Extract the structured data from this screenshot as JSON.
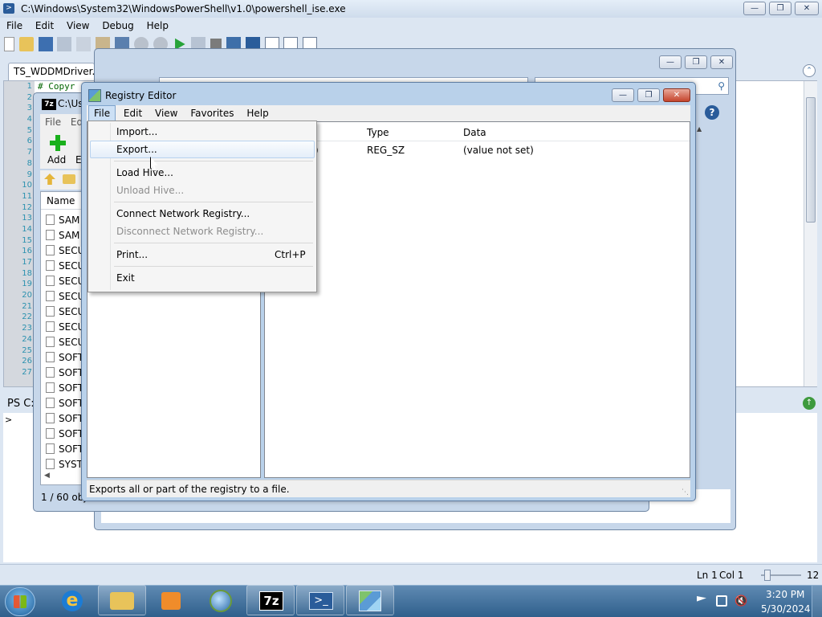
{
  "ise": {
    "title": "C:\\Windows\\System32\\WindowsPowerShell\\v1.0\\powershell_ise.exe",
    "menu": [
      "File",
      "Edit",
      "View",
      "Debug",
      "Help"
    ],
    "tab": "TS_WDDMDriver.ps",
    "code_comment": "# Copyr",
    "line_numbers": [
      "1",
      "2",
      "3",
      "4",
      "5",
      "6",
      "7",
      "8",
      "9",
      "10",
      "11",
      "12",
      "13",
      "14",
      "15",
      "16",
      "17",
      "18",
      "19",
      "20",
      "21",
      "22",
      "23",
      "24",
      "25",
      "26",
      "27"
    ],
    "console_prompt": "PS C:",
    "console_caret": ">",
    "status_ln": "Ln 1",
    "status_col": "Col 1",
    "zoom": "12"
  },
  "sevenzip": {
    "title": "C:\\Us",
    "menu": [
      "File",
      "Ed"
    ],
    "add_label": "Add",
    "extract_label": "E",
    "col_name": "Name",
    "files": [
      "SAM",
      "SAM",
      "SECU",
      "SECU",
      "SECU",
      "SECU",
      "SECU",
      "SECU",
      "SECU",
      "SOFT",
      "SOFT",
      "SOFT",
      "SOFT",
      "SOFT",
      "SOFT",
      "SOFT",
      "SYST"
    ],
    "status": "1 / 60 obj"
  },
  "regedit": {
    "title": "Registry Editor",
    "menu": [
      "File",
      "Edit",
      "View",
      "Favorites",
      "Help"
    ],
    "columns": {
      "type": "Type",
      "data": "Data"
    },
    "row": {
      "name_fragment": ")",
      "type": "REG_SZ",
      "data": "(value not set)"
    },
    "status": "Exports all or part of the registry to a file.",
    "file_menu": {
      "import": "Import...",
      "export": "Export...",
      "load_hive": "Load Hive...",
      "unload_hive": "Unload Hive...",
      "connect": "Connect Network Registry...",
      "disconnect": "Disconnect Network Registry...",
      "print": "Print...",
      "print_shortcut": "Ctrl+P",
      "exit": "Exit"
    }
  },
  "taskbar": {
    "time": "3:20 PM",
    "date": "5/30/2024"
  },
  "colors": {
    "accent": "#3a6ea5",
    "close_red": "#c5442c",
    "taskbar": "#2f5f8c"
  }
}
